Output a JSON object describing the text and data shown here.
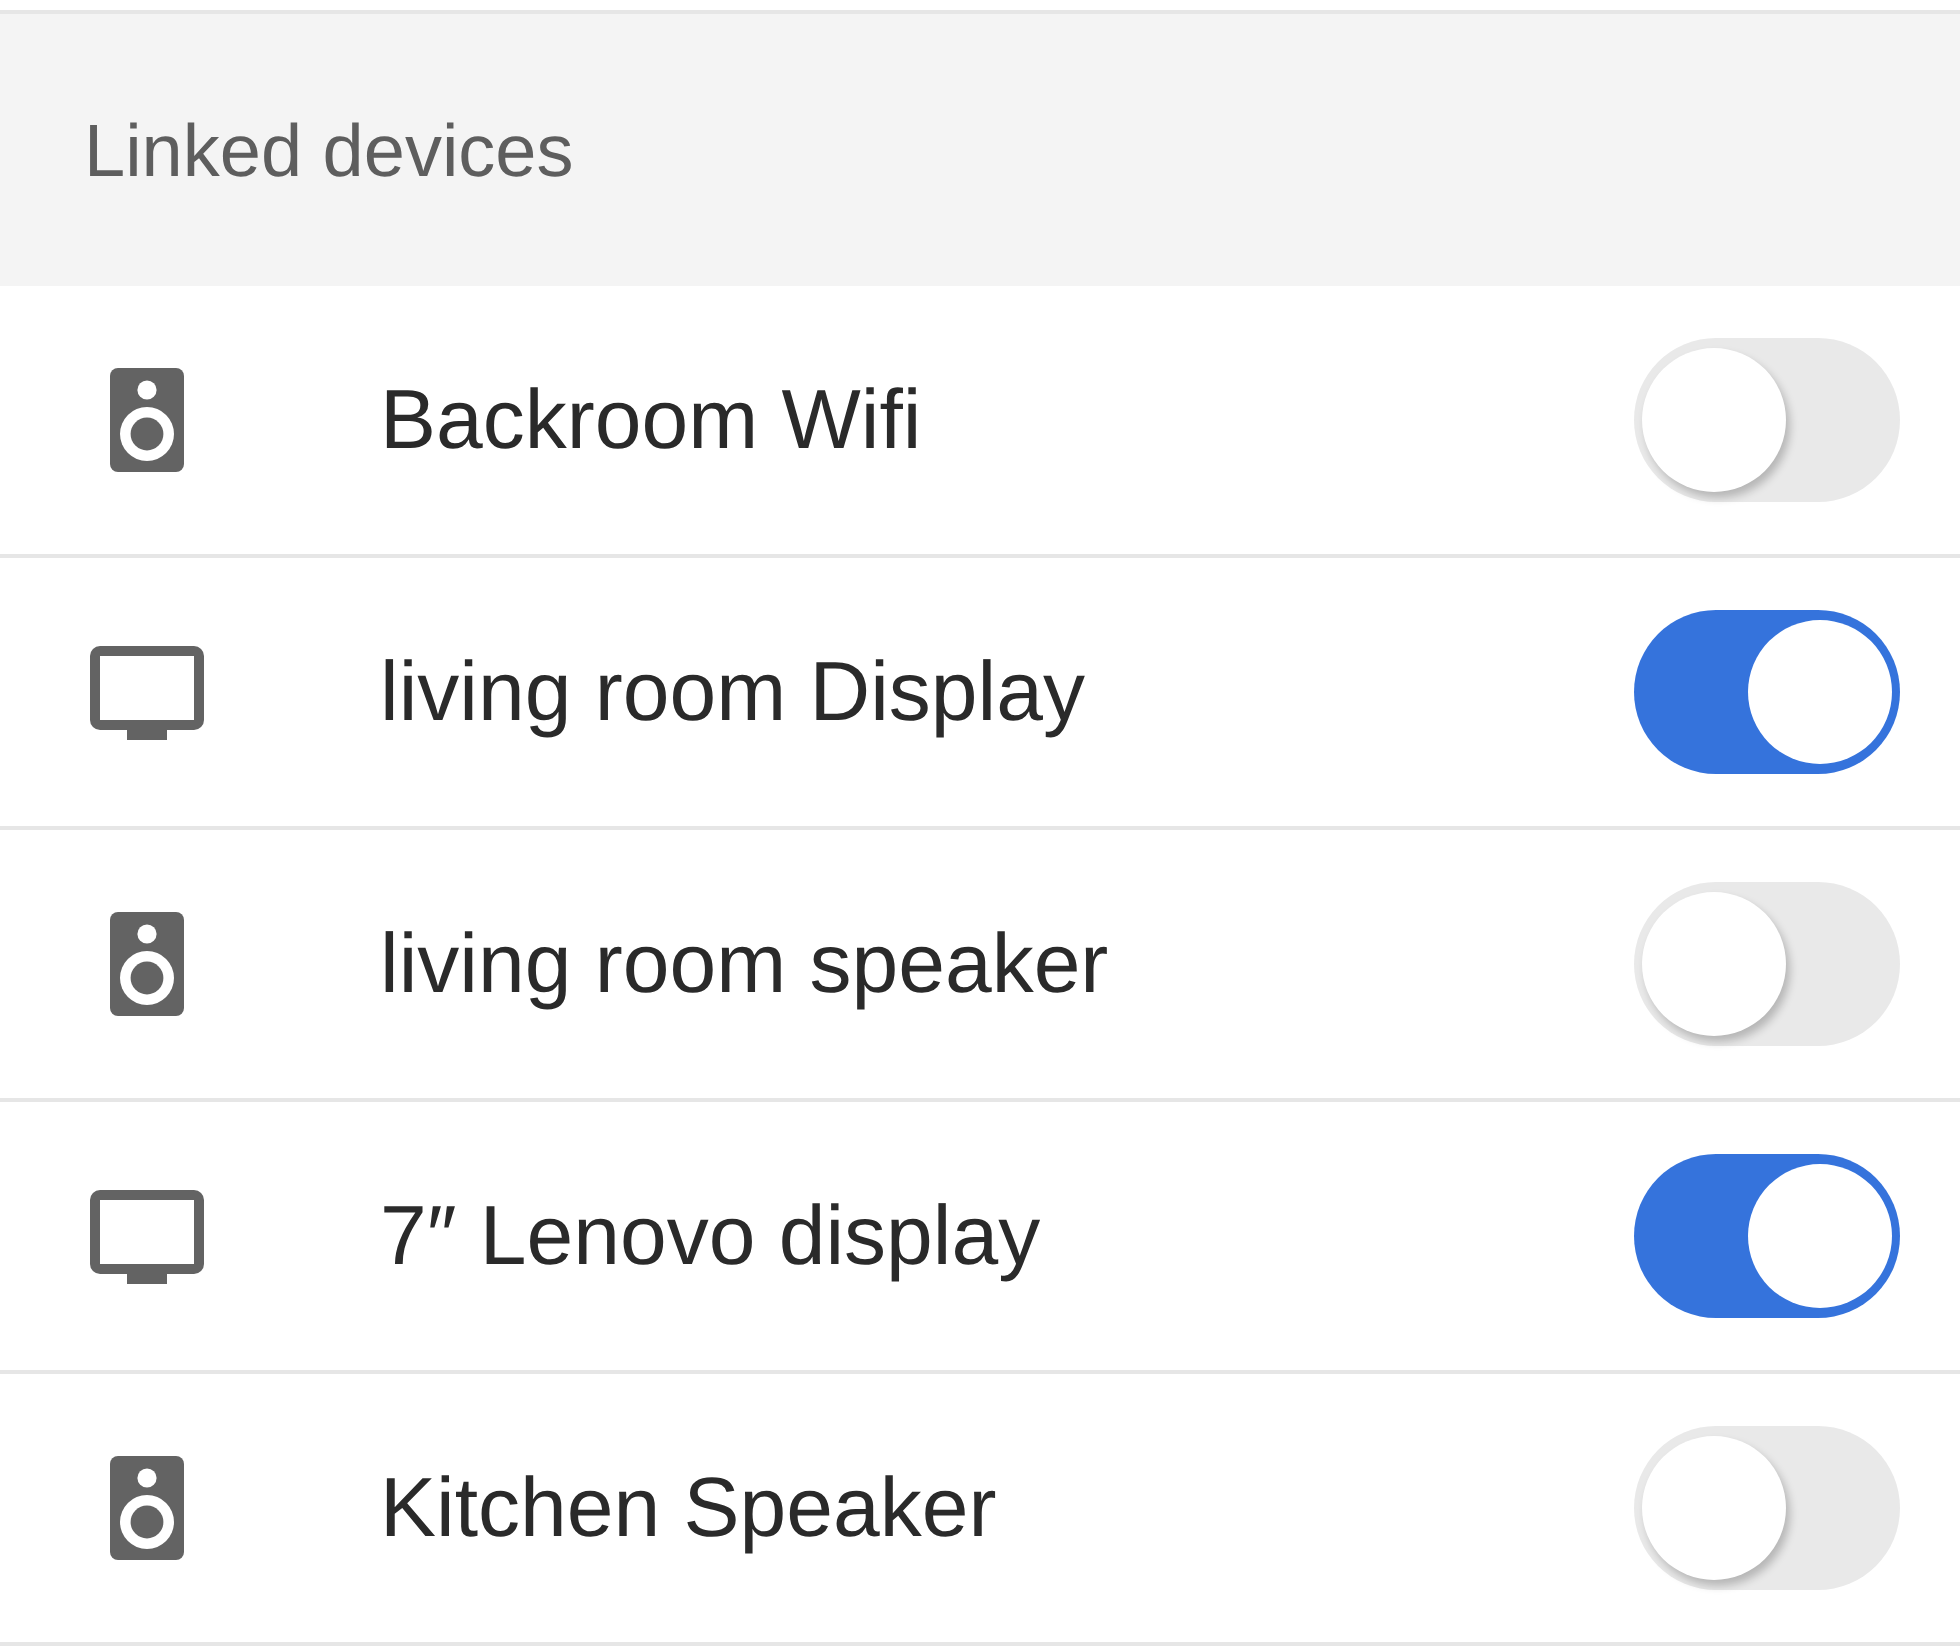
{
  "section": {
    "title": "Linked devices"
  },
  "devices": [
    {
      "kind": "speaker",
      "name": "Backroom Wifi",
      "on": false
    },
    {
      "kind": "display",
      "name": "living room Display",
      "on": true
    },
    {
      "kind": "speaker",
      "name": "living room speaker",
      "on": false
    },
    {
      "kind": "display",
      "name": "7″ Lenovo display",
      "on": true
    },
    {
      "kind": "speaker",
      "name": "Kitchen Speaker",
      "on": false
    }
  ]
}
